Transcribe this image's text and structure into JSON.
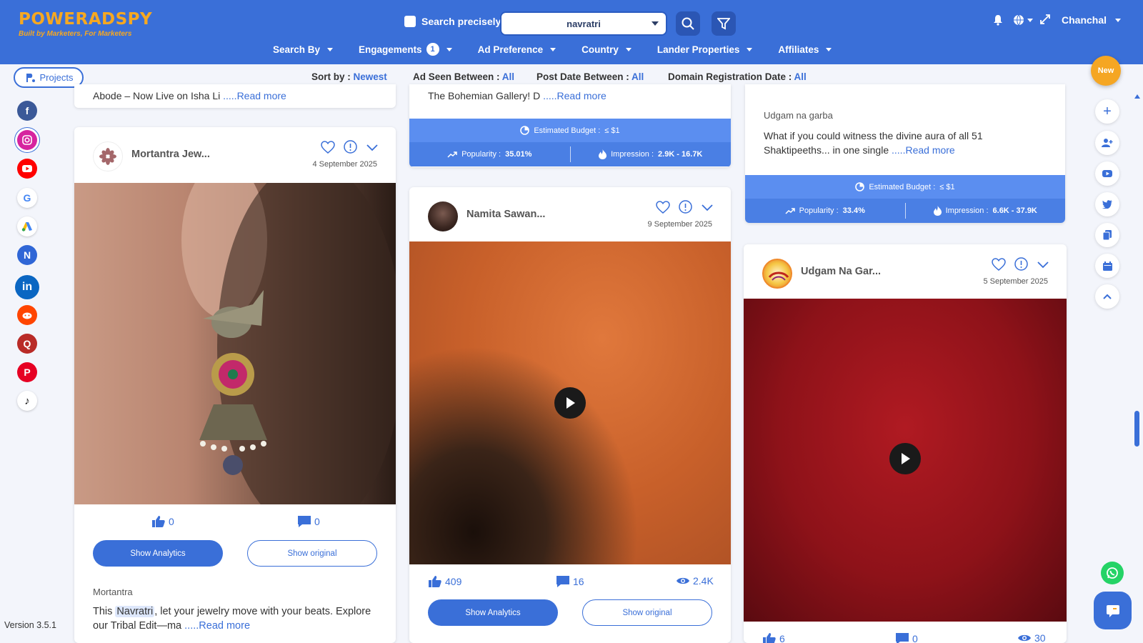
{
  "header": {
    "logo_text": "POWERADSPY",
    "logo_tagline": "Built by Marketers, For Marketers",
    "search_precisely_label": "Search precisely",
    "search_value": "navratri",
    "user_name": "Chanchal",
    "nav": [
      {
        "label": "Search By"
      },
      {
        "label": "Engagements",
        "badge": "1"
      },
      {
        "label": "Ad Preference"
      },
      {
        "label": "Country"
      },
      {
        "label": "Lander Properties"
      },
      {
        "label": "Affiliates"
      }
    ]
  },
  "filterbar": {
    "projects_label": "Projects",
    "sort_label": "Sort by :",
    "sort_value": "Newest",
    "ad_seen_label": "Ad Seen Between :",
    "ad_seen_value": "All",
    "post_date_label": "Post Date Between :",
    "post_date_value": "All",
    "domain_reg_label": "Domain Registration Date :",
    "domain_reg_value": "All",
    "new_badge": "New"
  },
  "sidebar": {
    "version": "Version 3.5.1",
    "platforms": [
      "facebook",
      "instagram",
      "youtube",
      "google",
      "google-ads",
      "native",
      "linkedin",
      "reddit",
      "quora",
      "pinterest",
      "tiktok"
    ]
  },
  "cards": {
    "c1_top": {
      "snippet": "Abode – Now Live on Isha Li",
      "read_more": ".....Read more"
    },
    "c2_top": {
      "snippet": "The Bohemian Gallery! D",
      "read_more": ".....Read more",
      "budget_label": "Estimated Budget :",
      "budget_value": "≤ $1",
      "popularity_label": "Popularity :",
      "popularity_value": "35.01%",
      "impression_label": "Impression :",
      "impression_value": "2.9K - 16.7K"
    },
    "c3_top": {
      "advertiser": "Udgam na garba",
      "snippet": "What if you could witness the divine aura of all 51 Shaktipeeths... in one single",
      "read_more": ".....Read more",
      "budget_label": "Estimated Budget :",
      "budget_value": "≤ $1",
      "popularity_label": "Popularity :",
      "popularity_value": "33.4%",
      "impression_label": "Impression :",
      "impression_value": "6.6K - 37.9K"
    },
    "mortantra": {
      "name": "Mortantra Jew...",
      "date": "4 September 2025",
      "likes": "0",
      "comments": "0",
      "show_analytics": "Show Analytics",
      "show_original": "Show original",
      "advertiser": "Mortantra",
      "snippet_pre": "This ",
      "snippet_highlight": "Navratri",
      "snippet_post": ", let your jewelry move with your beats. Explore our Tribal Edit—ma",
      "read_more": ".....Read more"
    },
    "namita": {
      "name": "Namita Sawan...",
      "date": "9 September 2025",
      "likes": "409",
      "comments": "16",
      "views": "2.4K",
      "show_analytics": "Show Analytics",
      "show_original": "Show original"
    },
    "udgam": {
      "name": "Udgam Na Gar...",
      "date": "5 September 2025",
      "likes": "6",
      "comments": "0",
      "views": "30"
    }
  }
}
